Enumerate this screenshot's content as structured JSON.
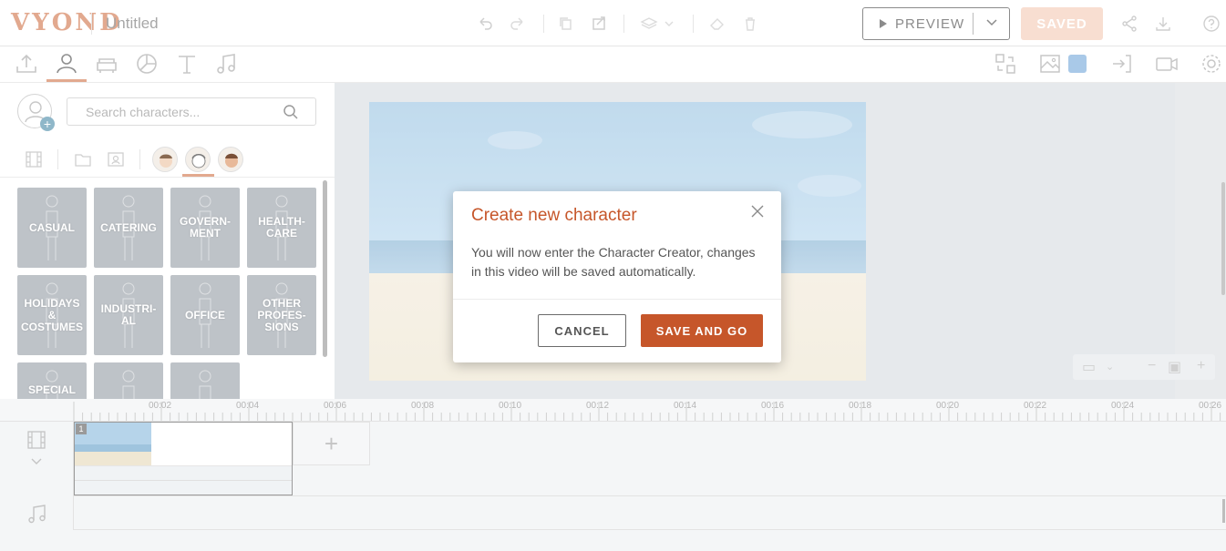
{
  "header": {
    "logo": "VYOND",
    "doc_title": "Untitled",
    "preview_label": "PREVIEW",
    "saved_label": "SAVED"
  },
  "icons": {
    "undo": "undo-icon",
    "redo": "redo-icon",
    "copy": "copy-icon",
    "paste": "paste-icon",
    "layers": "layers-icon",
    "eraser": "eraser-icon",
    "delete": "trash-icon",
    "share": "share-icon",
    "download": "download-icon",
    "help": "help-icon"
  },
  "colors": {
    "accent": "#c6562a",
    "logo": "#e2a98f",
    "saved_bg": "#f8ded1",
    "swatch": "#a9c9e8",
    "tile": "#bec3c8"
  },
  "library": {
    "search_placeholder": "Search characters...",
    "categories": [
      {
        "label": "CASUAL"
      },
      {
        "label": "CATERING"
      },
      {
        "label": "GOVERN-MENT"
      },
      {
        "label": "HEALTH-CARE"
      },
      {
        "label": "HOLIDAYS & COSTUMES"
      },
      {
        "label": "INDUSTRI-AL"
      },
      {
        "label": "OFFICE"
      },
      {
        "label": "OTHER PROFES-SIONS"
      },
      {
        "label": "SPECIAL"
      },
      {
        "label": ""
      },
      {
        "label": ""
      }
    ]
  },
  "modal": {
    "title": "Create new character",
    "body": "You will now enter the Character Creator, changes in this video will be saved automatically.",
    "cancel_label": "CANCEL",
    "confirm_label": "SAVE AND GO"
  },
  "timeline": {
    "ticks": [
      "00:02",
      "00:04",
      "00:06",
      "00:08",
      "00:10",
      "00:12",
      "00:14",
      "00:16",
      "00:18",
      "00:20",
      "00:22",
      "00:24",
      "00:26"
    ],
    "scene_number": "1",
    "add_label": "+"
  }
}
